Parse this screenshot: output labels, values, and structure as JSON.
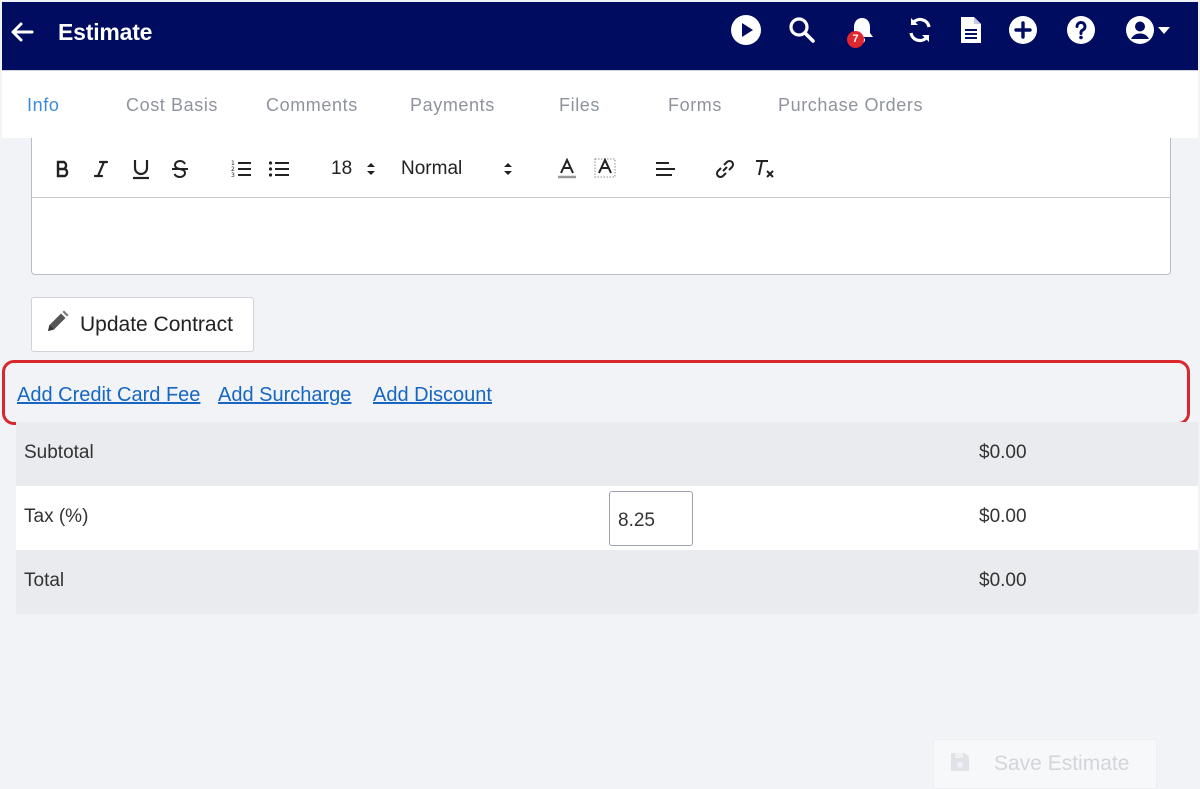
{
  "header": {
    "title": "Estimate",
    "notification_count": "7",
    "icons": [
      "back-arrow-icon",
      "play-icon",
      "search-icon",
      "bell-icon",
      "sync-icon",
      "document-icon",
      "plus-circle-icon",
      "help-icon",
      "user-icon",
      "caret-down-icon"
    ]
  },
  "tabs": [
    {
      "label": "Info",
      "active": true
    },
    {
      "label": "Cost Basis"
    },
    {
      "label": "Comments"
    },
    {
      "label": "Payments"
    },
    {
      "label": "Files"
    },
    {
      "label": "Forms"
    },
    {
      "label": "Purchase Orders"
    }
  ],
  "editor": {
    "font_size": "18",
    "format": "Normal",
    "tools": [
      "bold-icon",
      "italic-icon",
      "underline-icon",
      "strikethrough-icon",
      "ordered-list-icon",
      "bullet-list-icon",
      "text-color-icon",
      "background-color-icon",
      "align-icon",
      "link-icon",
      "clear-format-icon"
    ]
  },
  "update_contract_label": "Update Contract",
  "links": {
    "credit_card_fee": "Add Credit Card Fee ",
    "surcharge": "Add Surcharge ",
    "discount": "Add Discount"
  },
  "totals": {
    "subtotal_label": "Subtotal",
    "subtotal_value": "$0.00",
    "tax_label": "Tax (%)",
    "tax_rate": "8.25",
    "tax_value": "$0.00",
    "total_label": "Total",
    "total_value": "$0.00"
  },
  "save_label": "Save Estimate",
  "colors": {
    "header_bg": "#000c5f",
    "active_tab": "#3b8ad9",
    "link": "#1666c2",
    "highlight": "#d9272e",
    "badge": "#e0262e"
  }
}
